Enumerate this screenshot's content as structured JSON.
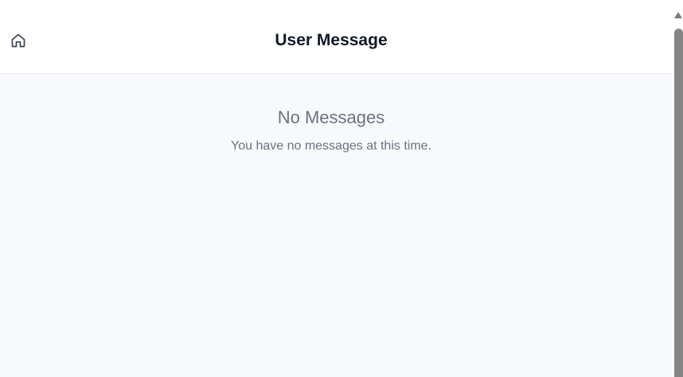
{
  "header": {
    "title": "User Message",
    "home_icon": "home-icon"
  },
  "empty_state": {
    "title": "No Messages",
    "message": "You have no messages at this time."
  },
  "colors": {
    "header_bg": "#ffffff",
    "page_bg": "#f8f9fb",
    "title_text": "#111827",
    "muted_text": "#6b7280",
    "border": "#e5e7eb",
    "scrollbar_thumb": "#858585"
  }
}
